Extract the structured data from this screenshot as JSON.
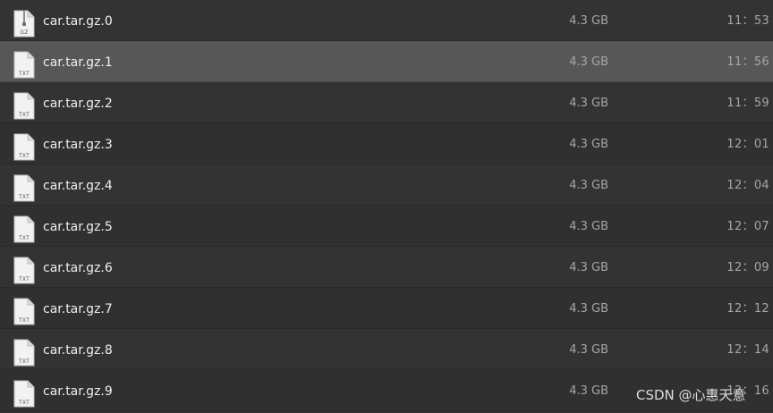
{
  "files": [
    {
      "name": "car.tar.gz.0",
      "size": "4.3 GB",
      "time": "11：53",
      "icon": "gz-archive-icon",
      "icon_label": "GZ"
    },
    {
      "name": "car.tar.gz.1",
      "size": "4.3 GB",
      "time": "11：56",
      "icon": "txt-file-icon",
      "icon_label": "TXT",
      "selected": true
    },
    {
      "name": "car.tar.gz.2",
      "size": "4.3 GB",
      "time": "11：59",
      "icon": "txt-file-icon",
      "icon_label": "TXT"
    },
    {
      "name": "car.tar.gz.3",
      "size": "4.3 GB",
      "time": "12：01",
      "icon": "txt-file-icon",
      "icon_label": "TXT"
    },
    {
      "name": "car.tar.gz.4",
      "size": "4.3 GB",
      "time": "12：04",
      "icon": "txt-file-icon",
      "icon_label": "TXT"
    },
    {
      "name": "car.tar.gz.5",
      "size": "4.3 GB",
      "time": "12：07",
      "icon": "txt-file-icon",
      "icon_label": "TXT"
    },
    {
      "name": "car.tar.gz.6",
      "size": "4.3 GB",
      "time": "12：09",
      "icon": "txt-file-icon",
      "icon_label": "TXT"
    },
    {
      "name": "car.tar.gz.7",
      "size": "4.3 GB",
      "time": "12：12",
      "icon": "txt-file-icon",
      "icon_label": "TXT"
    },
    {
      "name": "car.tar.gz.8",
      "size": "4.3 GB",
      "time": "12：14",
      "icon": "txt-file-icon",
      "icon_label": "TXT"
    },
    {
      "name": "car.tar.gz.9",
      "size": "4.3 GB",
      "time": "12：16",
      "icon": "txt-file-icon",
      "icon_label": "TXT"
    }
  ],
  "watermark": "CSDN @心惠天意",
  "colors": {
    "background": "#303030",
    "row_selected": "#575757",
    "name_text": "#eeeeee",
    "meta_text": "#a6a6a6"
  }
}
